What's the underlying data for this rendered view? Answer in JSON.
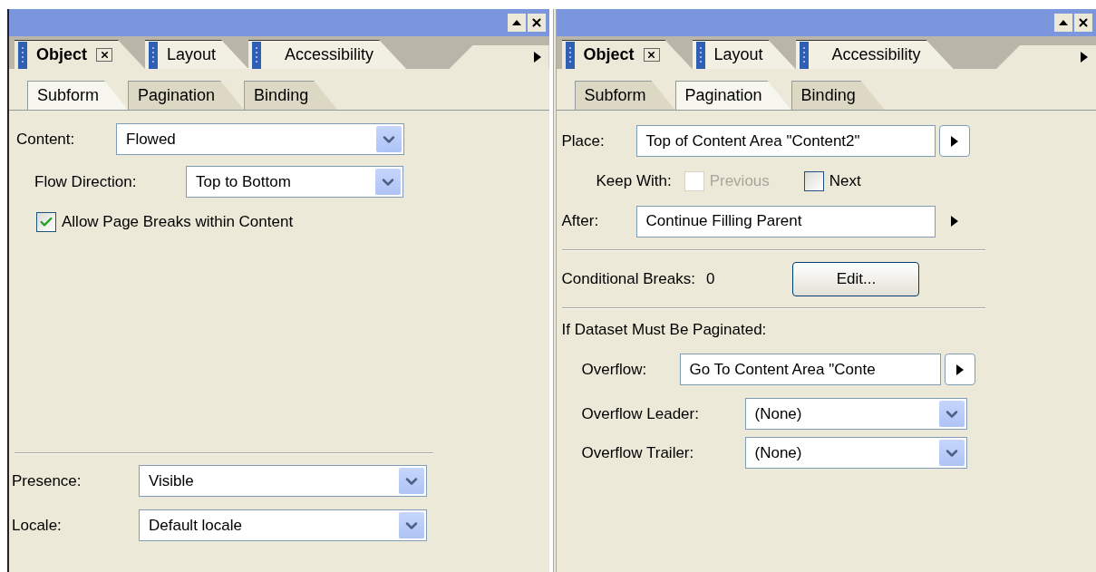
{
  "panels": [
    {
      "tabs": [
        {
          "label": "Object",
          "selected": true,
          "closable": true
        },
        {
          "label": "Layout",
          "selected": false,
          "closable": false
        },
        {
          "label": "Accessibility",
          "selected": false,
          "closable": false
        }
      ],
      "subtabs": [
        {
          "label": "Subform",
          "selected": true
        },
        {
          "label": "Pagination",
          "selected": false
        },
        {
          "label": "Binding",
          "selected": false
        }
      ],
      "rows": [
        {
          "kind": "select",
          "label": "Content:",
          "value": "Flowed"
        },
        {
          "kind": "select",
          "label": "Flow Direction:",
          "value": "Top to Bottom"
        },
        {
          "kind": "checkbox",
          "label": "Allow Page Breaks within Content",
          "checked": true,
          "disabled": false
        },
        {
          "kind": "spacer"
        },
        {
          "kind": "separator"
        },
        {
          "kind": "select",
          "label": "Presence:",
          "value": "Visible"
        },
        {
          "kind": "select",
          "label": "Locale:",
          "value": "Default locale"
        }
      ]
    },
    {
      "tabs": [
        {
          "label": "Object",
          "selected": true,
          "closable": true
        },
        {
          "label": "Layout",
          "selected": false,
          "closable": false
        },
        {
          "label": "Accessibility",
          "selected": false,
          "closable": false
        }
      ],
      "subtabs": [
        {
          "label": "Subform",
          "selected": false
        },
        {
          "label": "Pagination",
          "selected": true
        },
        {
          "label": "Binding",
          "selected": false
        }
      ],
      "rows": [
        {
          "kind": "picker",
          "label": "Place:",
          "value": "Top of Content Area \"Content2\"",
          "boxed": true
        },
        {
          "kind": "keep_with",
          "label": "Keep With:",
          "options": [
            {
              "label": "Previous",
              "checked": false,
              "disabled": true
            },
            {
              "label": "Next",
              "checked": false,
              "disabled": false
            }
          ]
        },
        {
          "kind": "picker",
          "label": "After:",
          "value": "Continue Filling Parent",
          "boxed": false
        },
        {
          "kind": "separator"
        },
        {
          "kind": "count",
          "label": "Conditional Breaks:",
          "value": "0",
          "button": "Edit..."
        },
        {
          "kind": "separator"
        },
        {
          "kind": "heading",
          "label": "If Dataset Must Be Paginated:"
        },
        {
          "kind": "picker",
          "label": "Overflow:",
          "value": "Go To Content Area \"Conte",
          "boxed": true
        },
        {
          "kind": "select",
          "label": "Overflow Leader:",
          "value": "(None)"
        },
        {
          "kind": "select",
          "label": "Overflow Trailer:",
          "value": "(None)"
        }
      ]
    }
  ]
}
